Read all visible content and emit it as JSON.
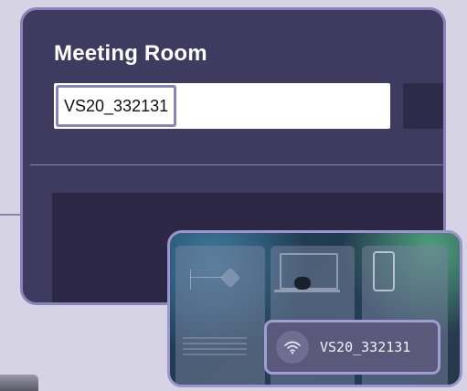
{
  "colors": {
    "page_bg": "#d6d3e4",
    "panel_bg": "#3e3a60",
    "panel_border": "#8a83b8",
    "field_bg": "#ffffff",
    "preview_border": "#9c94cc"
  },
  "meeting_room": {
    "title": "Meeting Room",
    "room_name_value": "VS20_332131"
  },
  "preview": {
    "network_name": "VS20_332131",
    "network_icon": "wifi-icon"
  }
}
